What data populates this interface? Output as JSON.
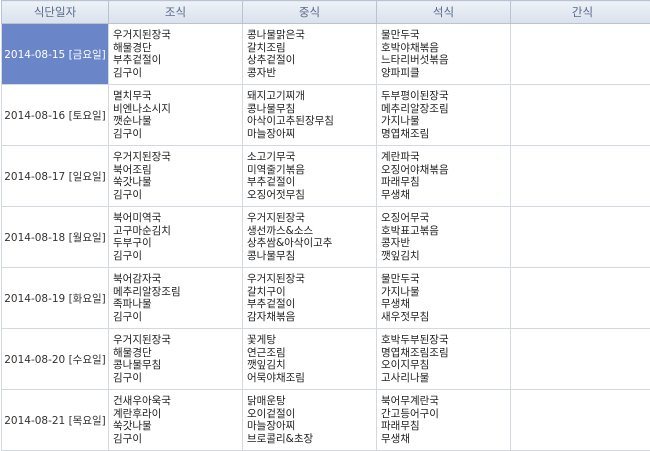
{
  "headers": [
    "식단일자",
    "조식",
    "중식",
    "석식",
    "간식"
  ],
  "rows": [
    {
      "date": "2014-08-15 [금요일]",
      "breakfast": [
        "우거지된장국",
        "해물경단",
        "부추겉절이",
        "김구이"
      ],
      "lunch": [
        "콩나물맑은국",
        "갈치조림",
        "상추겉절이",
        "콩자반"
      ],
      "dinner": [
        "물만두국",
        "호박야채볶음",
        "느타리버섯볶음",
        "양파피클"
      ],
      "snack": []
    },
    {
      "date": "2014-08-16 [토요일]",
      "breakfast": [
        "멸치무국",
        "비엔나소시지",
        "깻순나물",
        "김구이"
      ],
      "lunch": [
        "돼지고기찌개",
        "콩나물무침",
        "아삭이고추된장무침",
        "마늘장아찌"
      ],
      "dinner": [
        "두부평이된장국",
        "메추리알장조림",
        "가지나물",
        "명엽채조림"
      ],
      "snack": []
    },
    {
      "date": "2014-08-17 [일요일]",
      "breakfast": [
        "우거지된장국",
        "북어조림",
        "쑥갓나물",
        "김구이"
      ],
      "lunch": [
        "소고기무국",
        "미역줄기볶음",
        "부추겉절이",
        "오징어젓무침"
      ],
      "dinner": [
        "계란파국",
        "오징어야채볶음",
        "파래무침",
        "무생채"
      ],
      "snack": []
    },
    {
      "date": "2014-08-18 [월요일]",
      "breakfast": [
        "북어미역국",
        "고구마순김치",
        "두부구이",
        "김구이"
      ],
      "lunch": [
        "우거지된장국",
        "생선까스&소스",
        "상추쌈&아삭이고추",
        "콩나물무침"
      ],
      "dinner": [
        "오징어무국",
        "호박표고볶음",
        "콩자반",
        "깻잎김치"
      ],
      "snack": []
    },
    {
      "date": "2014-08-19 [화요일]",
      "breakfast": [
        "북어감자국",
        "메추리알장조림",
        "족파나물",
        "김구이"
      ],
      "lunch": [
        "우거지된장국",
        "갈치구이",
        "부추겉절이",
        "감자채볶음"
      ],
      "dinner": [
        "물만두국",
        "가지나물",
        "무생채",
        "새우젓무침"
      ],
      "snack": []
    },
    {
      "date": "2014-08-20 [수요일]",
      "breakfast": [
        "우거지된장국",
        "해물경단",
        "콩나물무침",
        "김구이"
      ],
      "lunch": [
        "꽃게탕",
        "연근조림",
        "깻잎김치",
        "어묵야채조림"
      ],
      "dinner": [
        "호박두부된장국",
        "명엽채조림조림",
        "오이지무침",
        "고사리나물"
      ],
      "snack": []
    },
    {
      "date": "2014-08-21 [목요일]",
      "breakfast": [
        "건새우아욱국",
        "계란후라이",
        "쑥갓나물",
        "김구이"
      ],
      "lunch": [
        "닭매운탕",
        "오이겉절이",
        "마늘장아찌",
        "브로콜리&초장"
      ],
      "dinner": [
        "북어무계란국",
        "간고등어구이",
        "파래무침",
        "무생채"
      ],
      "snack": []
    }
  ]
}
